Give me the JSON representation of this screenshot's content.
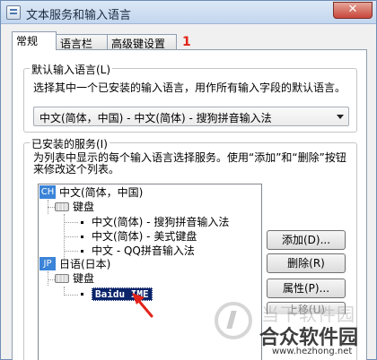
{
  "window": {
    "title": "文本服务和输入语言",
    "close_glyph": "✕"
  },
  "tabs": [
    {
      "label": "常规",
      "active": true
    },
    {
      "label": "语言栏",
      "active": false
    },
    {
      "label": "高级键设置",
      "active": false
    }
  ],
  "annotation_number": "1",
  "default_input": {
    "group_label": "默认输入语言(L)",
    "description": "选择其中一个已安装的输入语言，用作所有输入字段的默认语言。",
    "selected_value": "中文(简体，中国) - 中文(简体) - 搜狗拼音输入法"
  },
  "installed_services": {
    "group_label": "已安装的服务(I)",
    "description": "为列表中显示的每个输入语言选择服务。使用“添加”和“删除”按钮来修改这个列表。",
    "languages": [
      {
        "badge": "CH",
        "name": "中文(简体，中国)",
        "keyboard_label": "键盘",
        "keyboards": [
          "中文(简体) - 搜狗拼音输入法",
          "中文(简体) - 美式键盘",
          "中文 - QQ拼音输入法"
        ]
      },
      {
        "badge": "JP",
        "name": "日语(日本)",
        "keyboard_label": "键盘",
        "keyboards": [
          "Baidu IME"
        ]
      }
    ]
  },
  "buttons": {
    "add": "添加(D)...",
    "delete": "删除(R)",
    "properties": "属性(P)...",
    "partial": "上移(U)"
  },
  "watermark": {
    "line1": "当下软件园",
    "line2": "合众软件园",
    "line3": "www.hezhong.net"
  },
  "colors": {
    "accent": "#0a246a",
    "annotation": "#e2231a",
    "badge": "#3b84d8"
  },
  "icons": {
    "app": "keyboard-window-icon",
    "keyboard": "keyboard-icon",
    "language": "language-badge-icon"
  }
}
